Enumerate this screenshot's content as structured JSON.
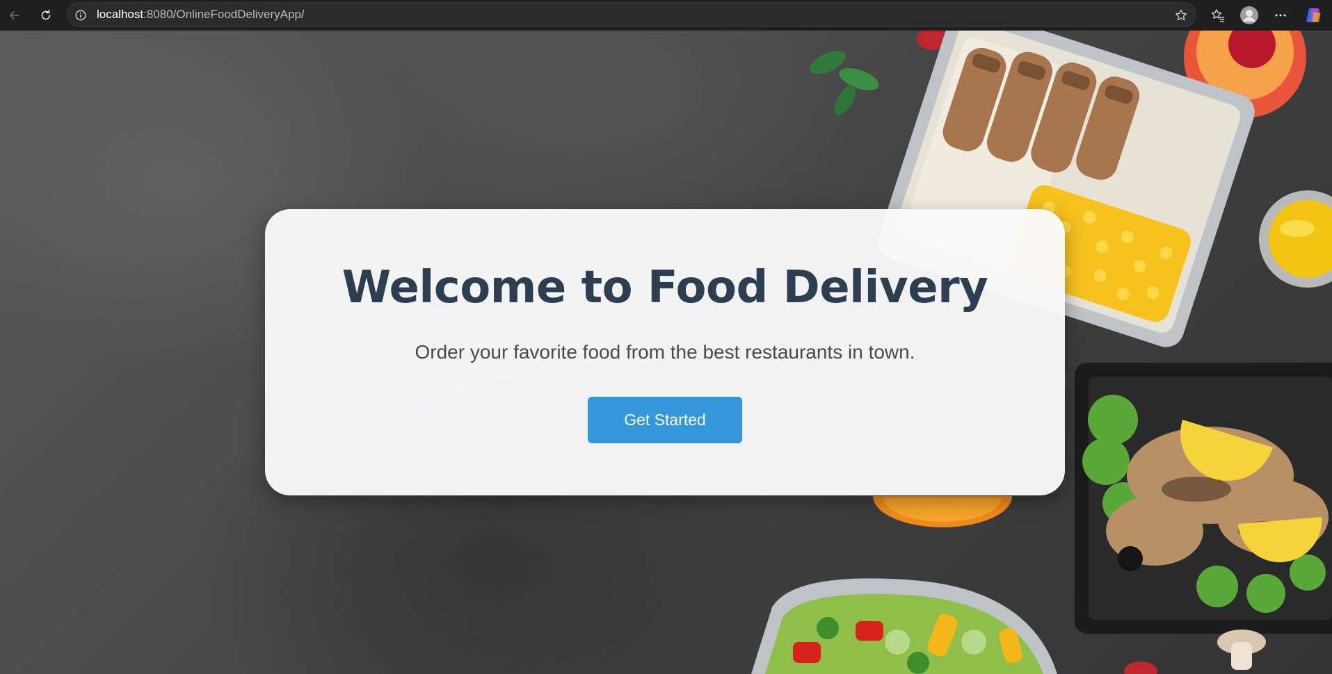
{
  "browser": {
    "url_host": "localhost",
    "url_rest": ":8080/OnlineFoodDeliveryApp/",
    "icons": {
      "back": "back-arrow-icon",
      "reload": "reload-icon",
      "site_info": "info-icon",
      "favorite": "star-icon",
      "favorites": "favorites-icon",
      "profile": "profile-icon",
      "menu": "more-icon",
      "copilot": "copilot-icon"
    }
  },
  "hero": {
    "title": "Welcome to Food Delivery",
    "subtitle": "Order your favorite food from the best restaurants in town.",
    "cta_label": "Get Started"
  },
  "colors": {
    "title": "#2c3e50",
    "button": "#3498db",
    "card": "#fafafb"
  }
}
